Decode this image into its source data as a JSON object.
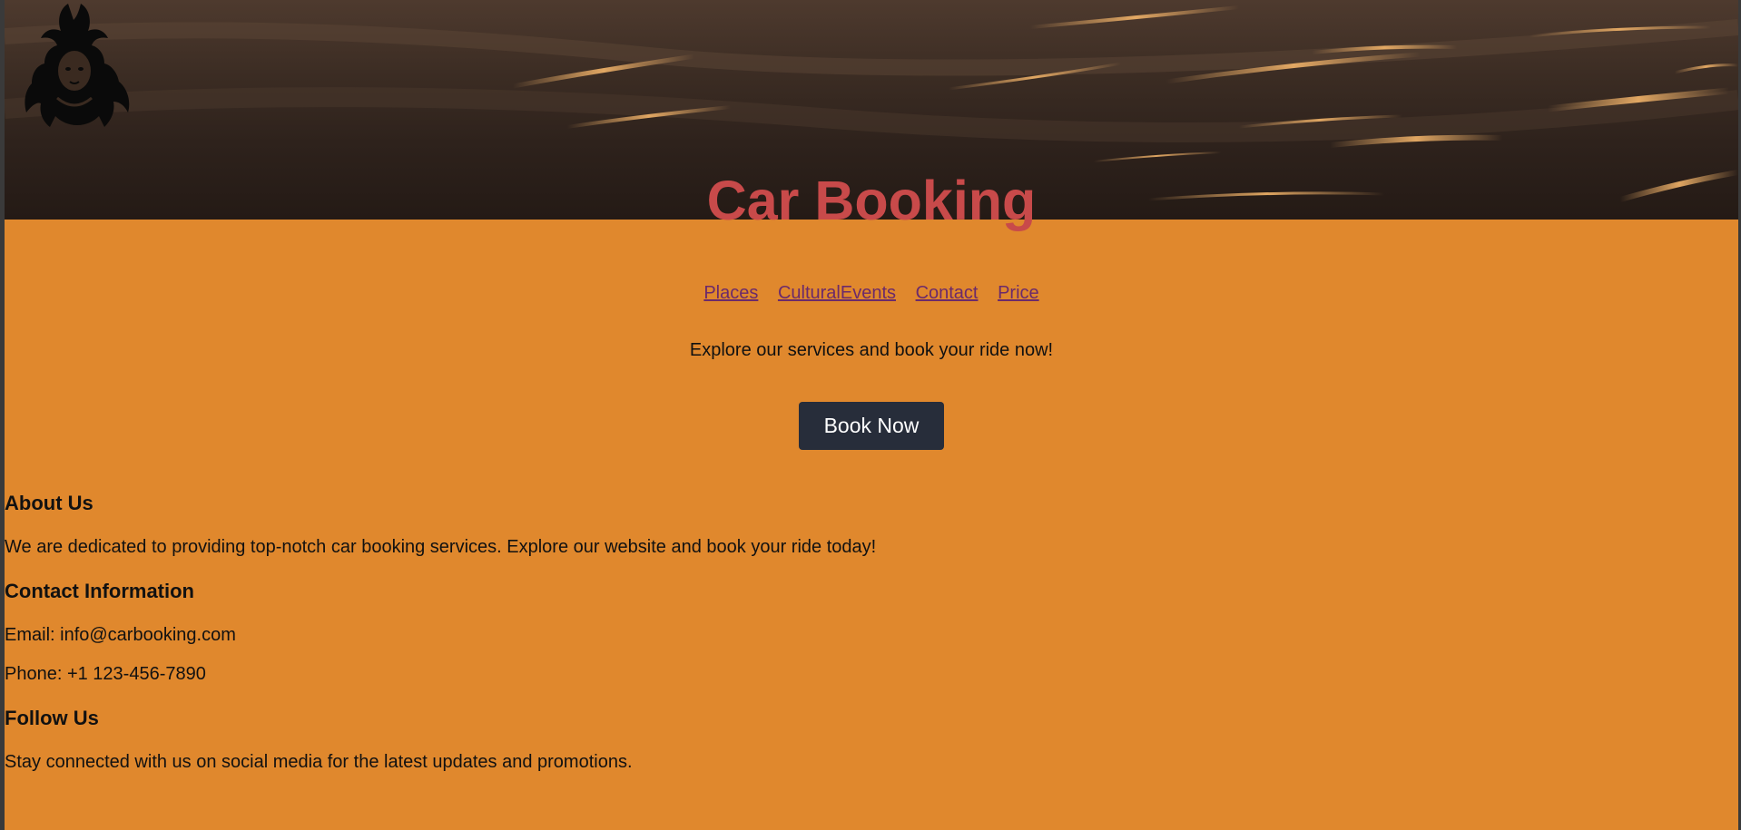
{
  "header": {
    "title": "Car Booking",
    "logo_icon": "deity-silhouette-icon"
  },
  "nav": {
    "links": [
      "Places",
      "CulturalEvents",
      "Contact",
      "Price"
    ]
  },
  "main": {
    "tagline": "Explore our services and book your ride now!",
    "book_button": "Book Now"
  },
  "about": {
    "heading": "About Us",
    "text": "We are dedicated to providing top-notch car booking services. Explore our website and book your ride today!"
  },
  "contact": {
    "heading": "Contact Information",
    "email": "Email: info@carbooking.com",
    "phone": "Phone: +1 123-456-7890"
  },
  "follow": {
    "heading": "Follow Us",
    "text": "Stay connected with us on social media for the latest updates and promotions."
  },
  "colors": {
    "page_background": "#e0882d",
    "title": "#c84a4a",
    "link": "#6b2a6b",
    "button": "#272d3a"
  }
}
